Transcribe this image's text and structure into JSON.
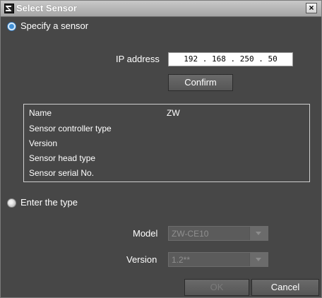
{
  "window": {
    "title": "Select Sensor",
    "close_glyph": "×"
  },
  "specify": {
    "radio_label": "Specify a sensor",
    "ip_label": "IP address",
    "ip_value": "192 . 168 . 250 .  50",
    "confirm_label": "Confirm"
  },
  "info": {
    "rows": [
      {
        "label": "Name",
        "value": "ZW"
      },
      {
        "label": "Sensor controller type",
        "value": ""
      },
      {
        "label": "Version",
        "value": ""
      },
      {
        "label": "Sensor head type",
        "value": ""
      },
      {
        "label": "Sensor serial No.",
        "value": ""
      }
    ]
  },
  "enter_type": {
    "radio_label": "Enter the type",
    "model_label": "Model",
    "model_value": "ZW-CE10",
    "version_label": "Version",
    "version_value": "1.2**"
  },
  "footer": {
    "ok_label": "OK",
    "cancel_label": "Cancel"
  },
  "colors": {
    "background": "#474747",
    "titlebar": "#a4a4a4",
    "radio_selected": "#3f8fd6"
  }
}
